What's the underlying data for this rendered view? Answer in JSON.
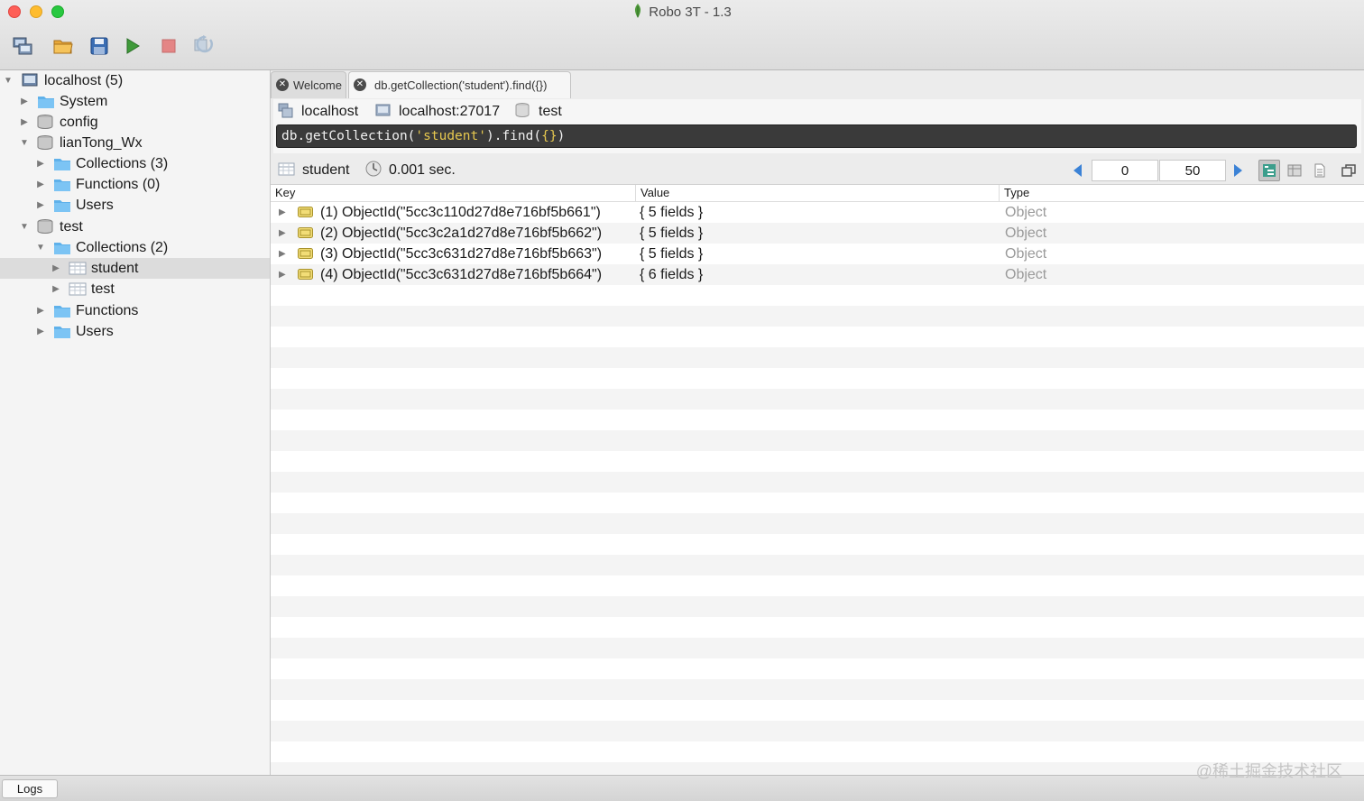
{
  "window": {
    "title": "Robo 3T - 1.3"
  },
  "toolbar": {
    "buttons": [
      {
        "icon": "connect-icon"
      },
      {
        "icon": "open-folder-icon"
      },
      {
        "icon": "save-icon"
      },
      {
        "icon": "play-icon"
      },
      {
        "icon": "stop-icon"
      },
      {
        "icon": "refresh-icon"
      }
    ]
  },
  "sidebar": {
    "items": [
      {
        "label": "localhost (5)",
        "icon": "server-icon",
        "expanded": true
      },
      {
        "label": "System",
        "icon": "folder-icon",
        "expanded": false
      },
      {
        "label": "config",
        "icon": "database-icon",
        "expanded": false
      },
      {
        "label": "lianTong_Wx",
        "icon": "database-icon",
        "expanded": true
      },
      {
        "label": "Collections (3)",
        "icon": "folder-icon",
        "expanded": false
      },
      {
        "label": "Functions (0)",
        "icon": "folder-icon",
        "expanded": false
      },
      {
        "label": "Users",
        "icon": "folder-icon",
        "expanded": false
      },
      {
        "label": "test",
        "icon": "database-icon",
        "expanded": true
      },
      {
        "label": "Collections (2)",
        "icon": "folder-icon",
        "expanded": true
      },
      {
        "label": "student",
        "icon": "collection-icon",
        "expanded": false,
        "selected": true
      },
      {
        "label": "test",
        "icon": "collection-icon",
        "expanded": false
      },
      {
        "label": "Functions",
        "icon": "folder-icon",
        "expanded": false
      },
      {
        "label": "Users",
        "icon": "folder-icon",
        "expanded": false
      }
    ]
  },
  "tabs": [
    {
      "label": "Welcome",
      "active": false
    },
    {
      "label": "db.getCollection('student').find({})",
      "active": true
    }
  ],
  "connection": {
    "host": "localhost",
    "server": "localhost:27017",
    "database": "test"
  },
  "editor": {
    "prefix": "db.getCollection(",
    "string": "'student'",
    "middle": ").find(",
    "braces": "{}",
    "suffix": ")"
  },
  "result": {
    "collection": "student",
    "time": "0.001 sec.",
    "skip": "0",
    "limit": "50"
  },
  "grid": {
    "headers": {
      "key": "Key",
      "value": "Value",
      "type": "Type"
    },
    "rows": [
      {
        "key": "(1) ObjectId(\"5cc3c110d27d8e716bf5b661\")",
        "value": "{ 5 fields }",
        "type": "Object"
      },
      {
        "key": "(2) ObjectId(\"5cc3c2a1d27d8e716bf5b662\")",
        "value": "{ 5 fields }",
        "type": "Object"
      },
      {
        "key": "(3) ObjectId(\"5cc3c631d27d8e716bf5b663\")",
        "value": "{ 5 fields }",
        "type": "Object"
      },
      {
        "key": "(4) ObjectId(\"5cc3c631d27d8e716bf5b664\")",
        "value": "{ 6 fields }",
        "type": "Object"
      }
    ]
  },
  "statusbar": {
    "logs_label": "Logs"
  },
  "watermark": {
    "text": "@稀土掘金技术社区"
  },
  "colors": {
    "accent": "#3b82d6",
    "editor_bg": "#3a3a3a",
    "string": "#e6c84f",
    "selected_row": "#dcdcdc"
  }
}
